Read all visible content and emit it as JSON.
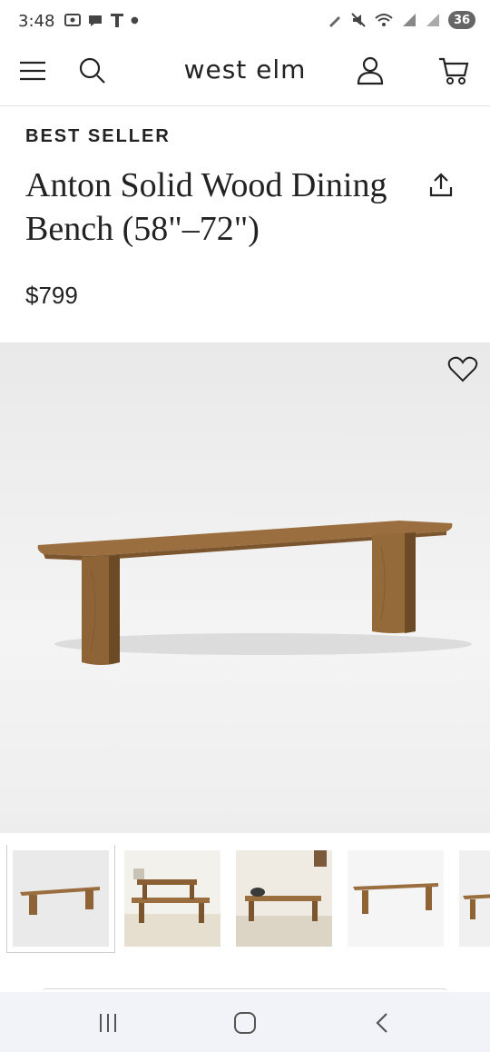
{
  "status_bar": {
    "time": "3:48",
    "battery": "36"
  },
  "header": {
    "logo": "west elm"
  },
  "product": {
    "badge": "BEST SELLER",
    "title": "Anton Solid Wood Dining Bench (58\"–72\")",
    "price": "$799"
  },
  "colors": {
    "wood": "#9a6e3f",
    "wood_dark": "#6d4a26",
    "hero_bg": "#ececec"
  },
  "icons": [
    "menu-icon",
    "search-icon",
    "account-icon",
    "cart-icon",
    "share-icon",
    "heart-icon"
  ],
  "thumbnails": [
    {
      "scene": "bench-studio",
      "selected": true
    },
    {
      "scene": "bench-dining-room",
      "selected": false
    },
    {
      "scene": "bench-hallway",
      "selected": false
    },
    {
      "scene": "bench-studio-alt",
      "selected": false
    },
    {
      "scene": "bench-partial",
      "selected": false
    }
  ]
}
